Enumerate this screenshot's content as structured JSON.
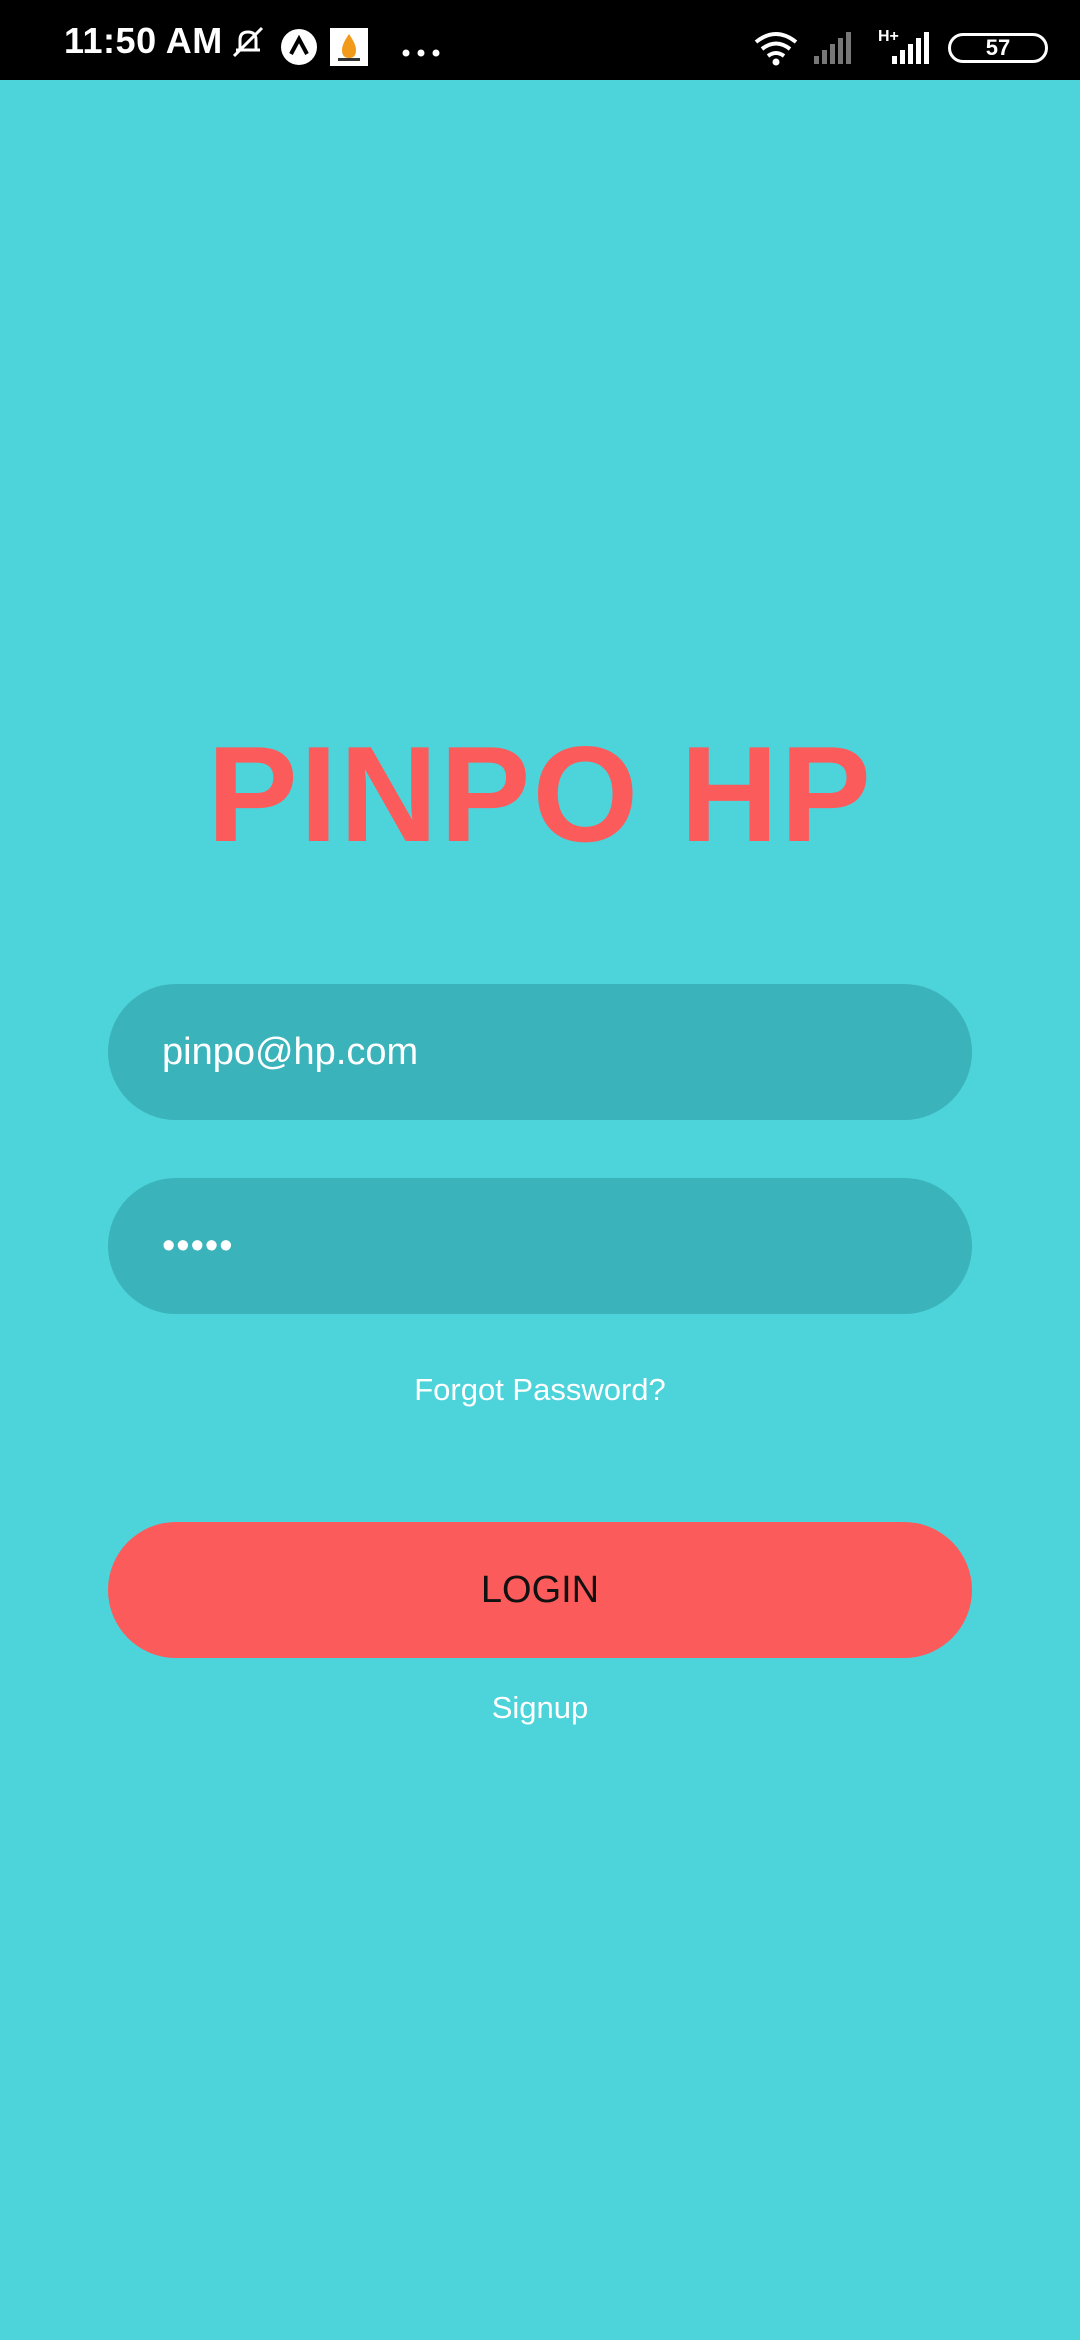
{
  "status_bar": {
    "time": "11:50 AM",
    "battery": "57",
    "network_label": "H+",
    "icons": [
      "mute-icon",
      "notification-a-icon",
      "app-flame-icon",
      "more-icon",
      "wifi-icon",
      "signal-weak-icon",
      "signal-strong-icon",
      "battery-icon"
    ]
  },
  "app": {
    "title": "PINPO HP",
    "email_value": "pinpo@hp.com",
    "password_value": "•••••",
    "forgot_label": "Forgot Password?",
    "login_label": "LOGIN",
    "signup_label": "Signup"
  },
  "colors": {
    "background": "#4dd3da",
    "field": "#3ab3bb",
    "accent": "#fb5b5b"
  }
}
